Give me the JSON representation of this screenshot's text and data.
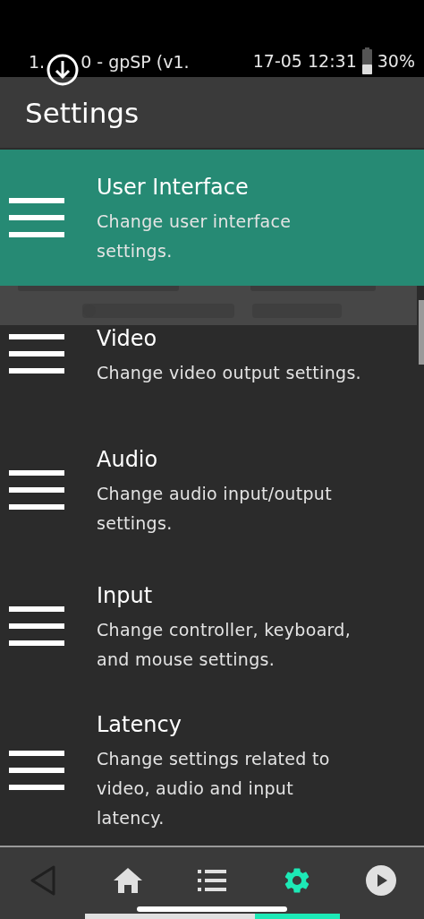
{
  "status_bar": {
    "app_info_start": "1.",
    "app_info_end": "0 - gpSP (v1.",
    "datetime": "17-05 12:31",
    "battery": "30%"
  },
  "header": {
    "title": "Settings"
  },
  "items": [
    {
      "title": "User Interface",
      "description": "Change user interface settings.",
      "selected": true
    },
    {
      "title": "Video",
      "description": "Change video output settings.",
      "selected": false
    },
    {
      "title": "Audio",
      "description": "Change audio input/output settings.",
      "selected": false
    },
    {
      "title": "Input",
      "description": "Change controller, keyboard, and mouse settings.",
      "selected": false
    },
    {
      "title": "Latency",
      "description": "Change settings related to video, audio and input latency.",
      "selected": false
    }
  ],
  "nav": [
    {
      "kind": "back",
      "selected": false
    },
    {
      "kind": "home",
      "selected": false
    },
    {
      "kind": "list",
      "selected": false
    },
    {
      "kind": "settings",
      "selected": true
    },
    {
      "kind": "play",
      "selected": false
    }
  ]
}
